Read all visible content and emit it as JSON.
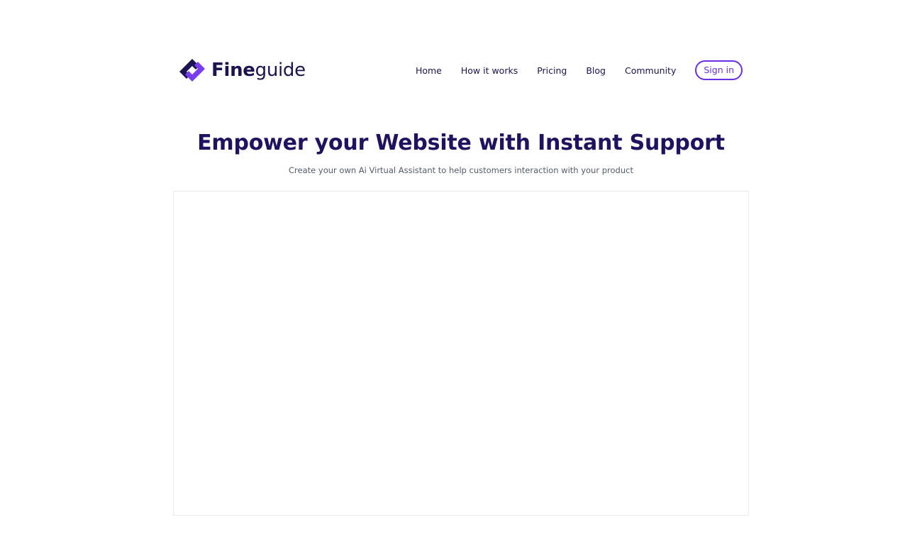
{
  "brand": {
    "name_bold": "Fine",
    "name_light": "guide",
    "logo_icon": "fineguide-logo-icon",
    "colors": {
      "dark": "#1a1450",
      "accent": "#6a2ee8"
    }
  },
  "nav": {
    "items": [
      {
        "label": "Home"
      },
      {
        "label": "How it works"
      },
      {
        "label": "Pricing"
      },
      {
        "label": "Blog"
      },
      {
        "label": "Community"
      }
    ],
    "signin_label": "Sign in"
  },
  "hero": {
    "title": "Empower your Website with Instant Support",
    "subtitle": "Create your own Ai Virtual Assistant to help customers interaction with your product"
  }
}
